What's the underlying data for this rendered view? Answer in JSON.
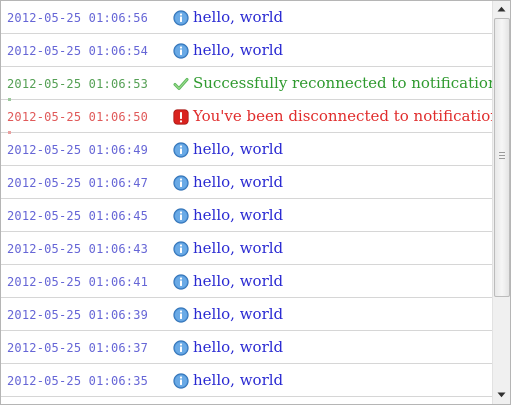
{
  "log": {
    "entries": [
      {
        "timestamp": "2012-05-25 01:06:56",
        "level": "info",
        "icon": "info-icon",
        "message": "hello, world"
      },
      {
        "timestamp": "2012-05-25 01:06:54",
        "level": "info",
        "icon": "info-icon",
        "message": "hello, world"
      },
      {
        "timestamp": "2012-05-25 01:06:53",
        "level": "success",
        "icon": "checkmark-icon",
        "message": "Successfully reconnected to notification"
      },
      {
        "timestamp": "2012-05-25 01:06:50",
        "level": "error",
        "icon": "error-icon",
        "message": "You've been disconnected to notification"
      },
      {
        "timestamp": "2012-05-25 01:06:49",
        "level": "info",
        "icon": "info-icon",
        "message": "hello, world"
      },
      {
        "timestamp": "2012-05-25 01:06:47",
        "level": "info",
        "icon": "info-icon",
        "message": "hello, world"
      },
      {
        "timestamp": "2012-05-25 01:06:45",
        "level": "info",
        "icon": "info-icon",
        "message": "hello, world"
      },
      {
        "timestamp": "2012-05-25 01:06:43",
        "level": "info",
        "icon": "info-icon",
        "message": "hello, world"
      },
      {
        "timestamp": "2012-05-25 01:06:41",
        "level": "info",
        "icon": "info-icon",
        "message": "hello, world"
      },
      {
        "timestamp": "2012-05-25 01:06:39",
        "level": "info",
        "icon": "info-icon",
        "message": "hello, world"
      },
      {
        "timestamp": "2012-05-25 01:06:37",
        "level": "info",
        "icon": "info-icon",
        "message": "hello, world"
      },
      {
        "timestamp": "2012-05-25 01:06:35",
        "level": "info",
        "icon": "info-icon",
        "message": "hello, world"
      }
    ]
  },
  "colors": {
    "info_text": "#2a2ad2",
    "info_timestamp": "#6666d6",
    "info_icon": "#4a8fd4",
    "success_text": "#2f9a2f",
    "success_timestamp": "#55a055",
    "success_icon": "#5cb85c",
    "error_text": "#e02c2c",
    "error_timestamp": "#e05a5a",
    "error_icon": "#d9231f"
  },
  "scrollbar": {
    "icons": {
      "up": "arrow-up-icon",
      "down": "arrow-down-icon"
    }
  }
}
